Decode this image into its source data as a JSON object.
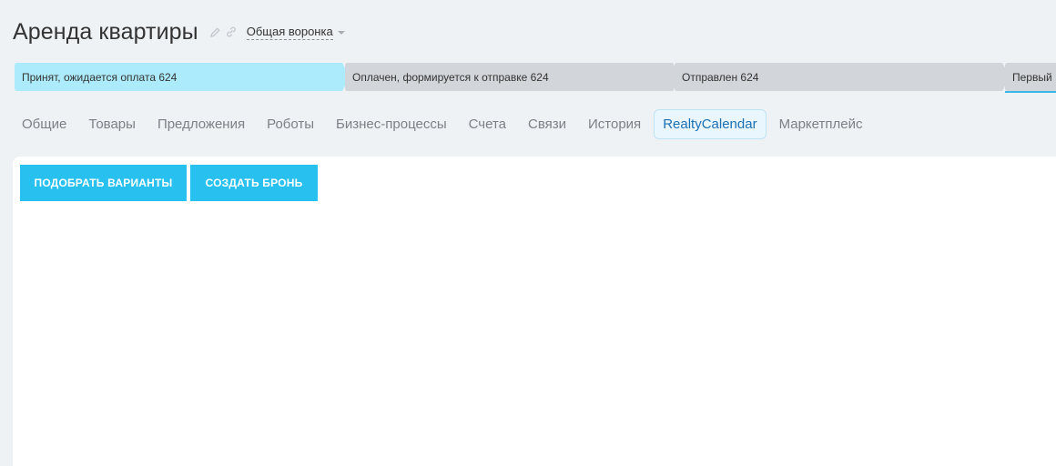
{
  "deal": {
    "title": "Аренда квартиры",
    "funnel_label": "Общая воронка"
  },
  "stages": [
    {
      "label": "Принят, ожидается оплата 624",
      "state": "current",
      "color": "#acebfb"
    },
    {
      "label": "Оплачен, формируется к отправке 624",
      "state": "inactive",
      "color": "#d2d5d9"
    },
    {
      "label": "Отправлен 624",
      "state": "inactive",
      "color": "#d2d5d9"
    },
    {
      "label": "Первый",
      "state": "inactive",
      "color": "#d2d5d9",
      "underline_color": "#39b7e6"
    }
  ],
  "tabs": [
    {
      "label": "Общие",
      "active": false
    },
    {
      "label": "Товары",
      "active": false
    },
    {
      "label": "Предложения",
      "active": false
    },
    {
      "label": "Роботы",
      "active": false
    },
    {
      "label": "Бизнес-процессы",
      "active": false
    },
    {
      "label": "Счета",
      "active": false
    },
    {
      "label": "Связи",
      "active": false
    },
    {
      "label": "История",
      "active": false
    },
    {
      "label": "RealtyCalendar",
      "active": true
    },
    {
      "label": "Маркетплейс",
      "active": false
    }
  ],
  "content": {
    "pick_options_label": "ПОДОБРАТЬ ВАРИАНТЫ",
    "create_booking_label": "СОЗДАТЬ БРОНЬ"
  },
  "colors": {
    "accent": "#28c0ee",
    "active_tab_text": "#1c71b4"
  }
}
